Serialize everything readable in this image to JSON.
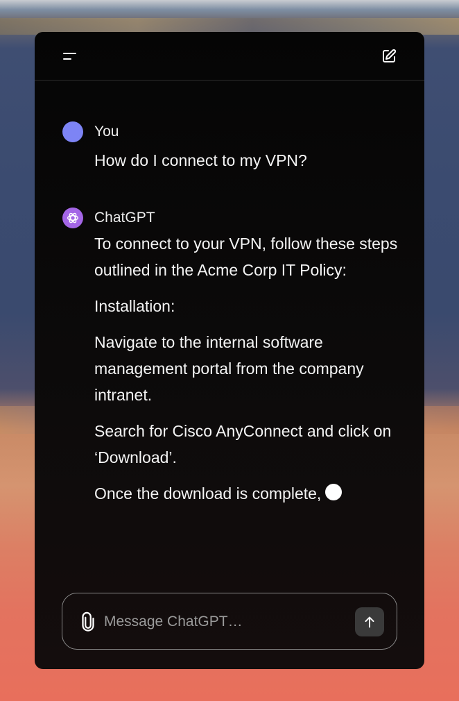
{
  "header": {
    "menu_icon": "menu-icon",
    "new_chat_icon": "compose-icon"
  },
  "conversation": {
    "user": {
      "author": "You",
      "avatar_color": "#7d84f5",
      "text": "How do I connect to my VPN?"
    },
    "assistant": {
      "author": "ChatGPT",
      "avatar_color": "#a466e6",
      "paragraphs": [
        "To connect to your VPN, follow these steps outlined in the Acme Corp IT Policy:",
        "Installation:",
        "Navigate to the internal software management portal from the company intranet.",
        "Search for Cisco AnyConnect and click on ‘Download’.",
        "Once the download is complete,"
      ]
    }
  },
  "composer": {
    "placeholder": "Message ChatGPT…",
    "value": "",
    "attach_icon": "paperclip-icon",
    "send_icon": "arrow-up-icon"
  }
}
